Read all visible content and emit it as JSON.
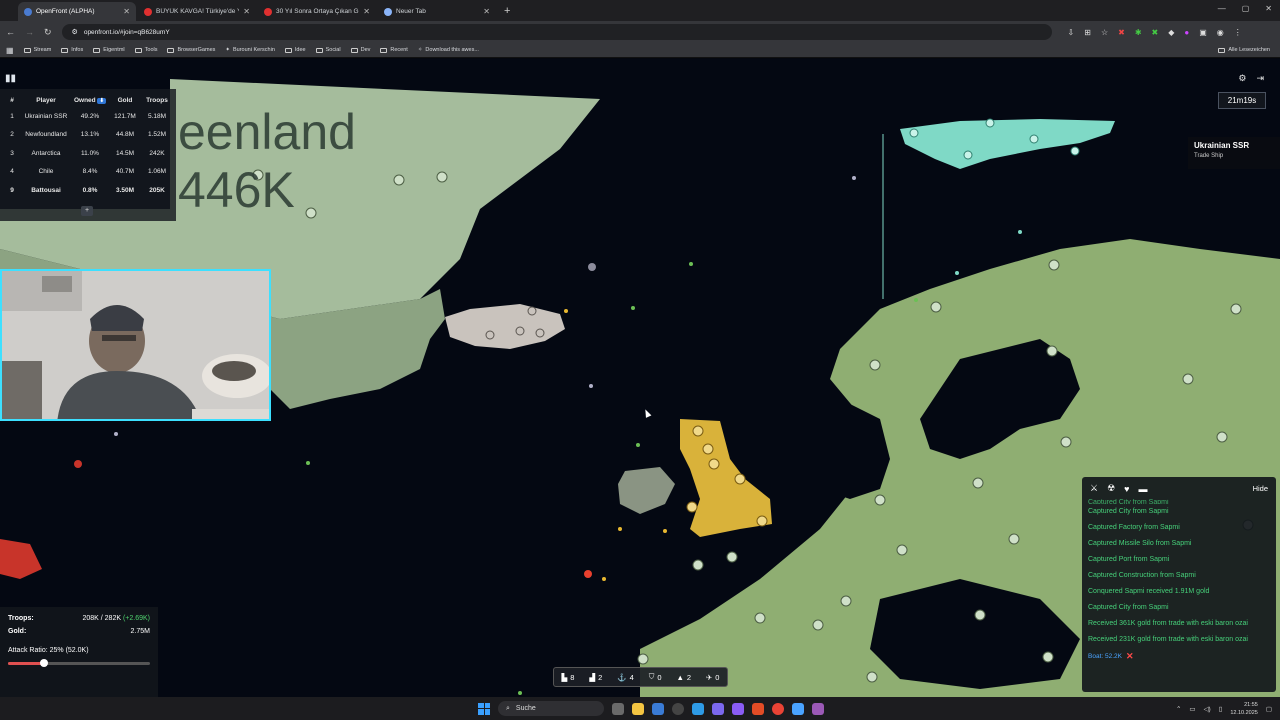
{
  "browser": {
    "tabs": [
      {
        "title": "OpenFront (ALPHA)",
        "favicon_color": "#4a7bd0",
        "active": true
      },
      {
        "title": "BÜYÜK KAVGA! Türkiye'de Yaşa",
        "favicon_color": "#e03030",
        "active": false
      },
      {
        "title": "30 Yıl Sonra Ortaya Çıkan Gerçe",
        "favicon_color": "#e03030",
        "active": false
      },
      {
        "title": "Neuer Tab",
        "favicon_color": "#8ab4f8",
        "active": false
      }
    ],
    "url": "openfront.io/#join=qB628umY",
    "bookmarks": [
      "Stream",
      "Infos",
      "Eigentml",
      "Tools",
      "BrowserGames",
      "Burouni Kerschin",
      "Idee",
      "Social",
      "Dev",
      "Recent",
      "Download this awes..."
    ],
    "all_bookmarks_label": "Alle Lesezeichen"
  },
  "map": {
    "label_line1": "eenland",
    "label_line2": "446K"
  },
  "leaderboard": {
    "headers": [
      "#",
      "Player",
      "Owned",
      "Gold",
      "Troops"
    ],
    "rows": [
      {
        "rank": "1",
        "player": "Ukrainian SSR",
        "owned": "49.2%",
        "gold": "121.7M",
        "troops": "5.18M"
      },
      {
        "rank": "2",
        "player": "Newfoundland",
        "owned": "13.1%",
        "gold": "44.8M",
        "troops": "1.52M"
      },
      {
        "rank": "3",
        "player": "Antarctica",
        "owned": "11.0%",
        "gold": "14.5M",
        "troops": "242K"
      },
      {
        "rank": "4",
        "player": "Chile",
        "owned": "8.4%",
        "gold": "40.7M",
        "troops": "1.06M"
      },
      {
        "rank": "9",
        "player": "Battousai",
        "owned": "0.8%",
        "gold": "3.50M",
        "troops": "205K"
      }
    ],
    "expand_label": "+"
  },
  "timer": "21m19s",
  "player_info": {
    "name": "Ukrainian SSR",
    "subtitle": "Trade Ship"
  },
  "event_log": {
    "hide_label": "Hide",
    "partial_top": "Captured City from Sapmi",
    "events": [
      "Captured City from Sapmi",
      "Captured Factory from Sapmi",
      "Captured Missile Silo from Sapmi",
      "Captured Port from Sapmi",
      "Captured Construction from Sapmi",
      "Conquered Sapmi received 1.91M gold",
      "Captured City from Sapmi",
      "Received 361K gold from trade with eski baron ozai",
      "Received 231K gold from trade with eski baron ozai"
    ],
    "boat": "Boat: 52.2K"
  },
  "stats": {
    "troops_label": "Troops:",
    "troops_value": "208K / 282K",
    "troops_rate": "(+2.69K)",
    "gold_label": "Gold:",
    "gold_value": "2.75M",
    "attack_ratio": "Attack Ratio: 25% (52.0K)",
    "attack_ratio_fraction": 0.25
  },
  "units": [
    {
      "icon": "city-icon",
      "glyph": "▙",
      "count": "8"
    },
    {
      "icon": "factory-icon",
      "glyph": "▟",
      "count": "2"
    },
    {
      "icon": "anchor-icon",
      "glyph": "⚓",
      "count": "4"
    },
    {
      "icon": "shield-icon",
      "glyph": "⛉",
      "count": "0"
    },
    {
      "icon": "sam-icon",
      "glyph": "▲",
      "count": "2"
    },
    {
      "icon": "missile-icon",
      "glyph": "✈",
      "count": "0"
    }
  ],
  "taskbar": {
    "search_placeholder": "Suche",
    "time": "21:55",
    "date": "12.10.2025",
    "app_colors": [
      "#f4c542",
      "#3a7bd5",
      "#6a6a6a",
      "#2e9be6",
      "#7b68ee",
      "#e34c26",
      "#4aa3ff",
      "#8a5cf5",
      "#ea4335",
      "#9b59b6"
    ]
  },
  "colors": {
    "ocean": "#040812",
    "land_green": "#8fae72",
    "ukraine_ssr": "#7fd9c6",
    "player_yellow": "#d9b23a",
    "greenland_grey": "#c9c3bd"
  }
}
